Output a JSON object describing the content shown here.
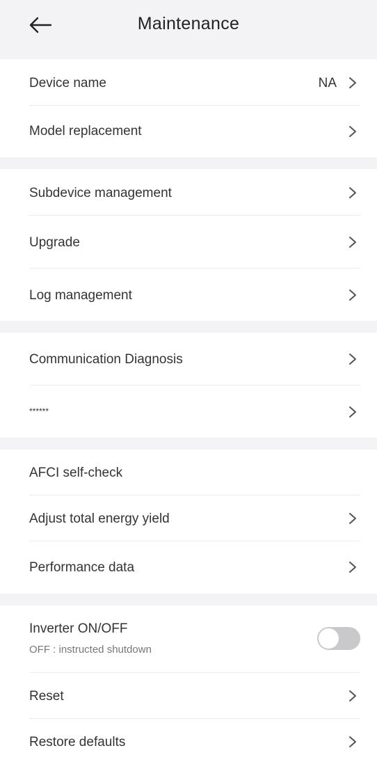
{
  "header": {
    "title": "Maintenance"
  },
  "groups": [
    {
      "items": [
        {
          "label": "Device name",
          "value": "NA"
        },
        {
          "label": "Model replacement"
        }
      ]
    },
    {
      "items": [
        {
          "label": "Subdevice management"
        },
        {
          "label": "Upgrade"
        },
        {
          "label": "Log management"
        }
      ]
    },
    {
      "items": [
        {
          "label": "Communication Diagnosis"
        },
        {
          "label": "******"
        }
      ]
    },
    {
      "items": [
        {
          "label": "AFCI self-check"
        },
        {
          "label": "Adjust total energy yield"
        },
        {
          "label": "Performance data"
        }
      ]
    },
    {
      "items": [
        {
          "label": "Inverter ON/OFF",
          "sublabel": "OFF : instructed shutdown",
          "toggle_state": "off"
        },
        {
          "label": "Reset"
        },
        {
          "label": "Restore defaults"
        }
      ]
    }
  ],
  "colors": {
    "background": "#f3f3f5",
    "card": "#ffffff",
    "toggle_off": "#c9c9cc"
  },
  "icons": {
    "back": "arrow-left-icon",
    "chevron": "chevron-right-icon"
  }
}
